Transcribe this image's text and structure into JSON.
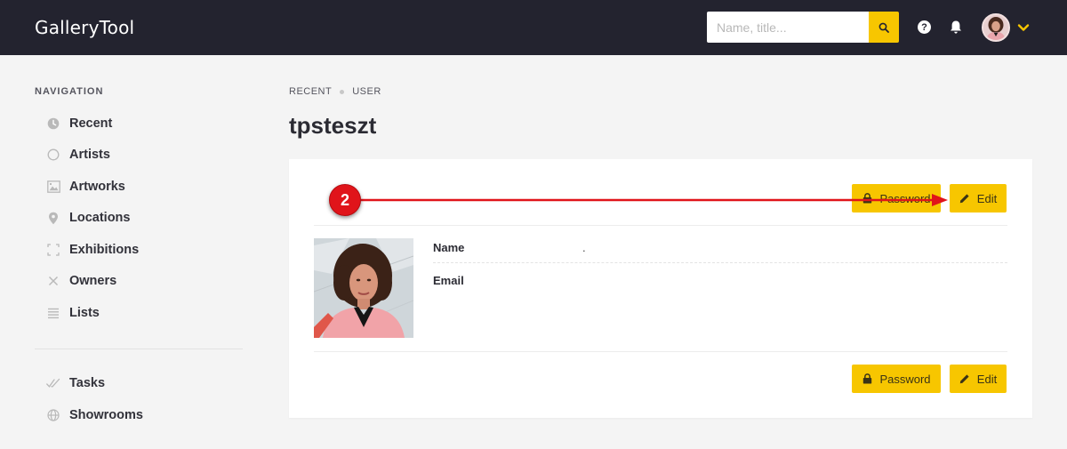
{
  "app": {
    "brand": "GalleryTool"
  },
  "header": {
    "search_placeholder": "Name, title..."
  },
  "sidebar": {
    "heading": "NAVIGATION",
    "items": [
      {
        "label": "Recent",
        "icon": "clock-icon"
      },
      {
        "label": "Artists",
        "icon": "circle-icon"
      },
      {
        "label": "Artworks",
        "icon": "image-icon"
      },
      {
        "label": "Locations",
        "icon": "map-pin-icon"
      },
      {
        "label": "Exhibitions",
        "icon": "frame-corners-icon"
      },
      {
        "label": "Owners",
        "icon": "x-icon"
      },
      {
        "label": "Lists",
        "icon": "list-icon"
      }
    ],
    "secondary_items": [
      {
        "label": "Tasks",
        "icon": "double-check-icon"
      },
      {
        "label": "Showrooms",
        "icon": "globe-icon"
      }
    ]
  },
  "breadcrumb": {
    "items": [
      "RECENT",
      "USER"
    ]
  },
  "page": {
    "title": "tpsteszt"
  },
  "user_card": {
    "password_label": "Password",
    "edit_label": "Edit",
    "fields": [
      {
        "label": "Name",
        "value": "."
      },
      {
        "label": "Email",
        "value": ""
      }
    ]
  },
  "annotation": {
    "step_number": "2"
  },
  "colors": {
    "topbar": "#23232f",
    "accent": "#f7c600",
    "annotation_red": "#e0141a",
    "background": "#f4f4f4"
  }
}
